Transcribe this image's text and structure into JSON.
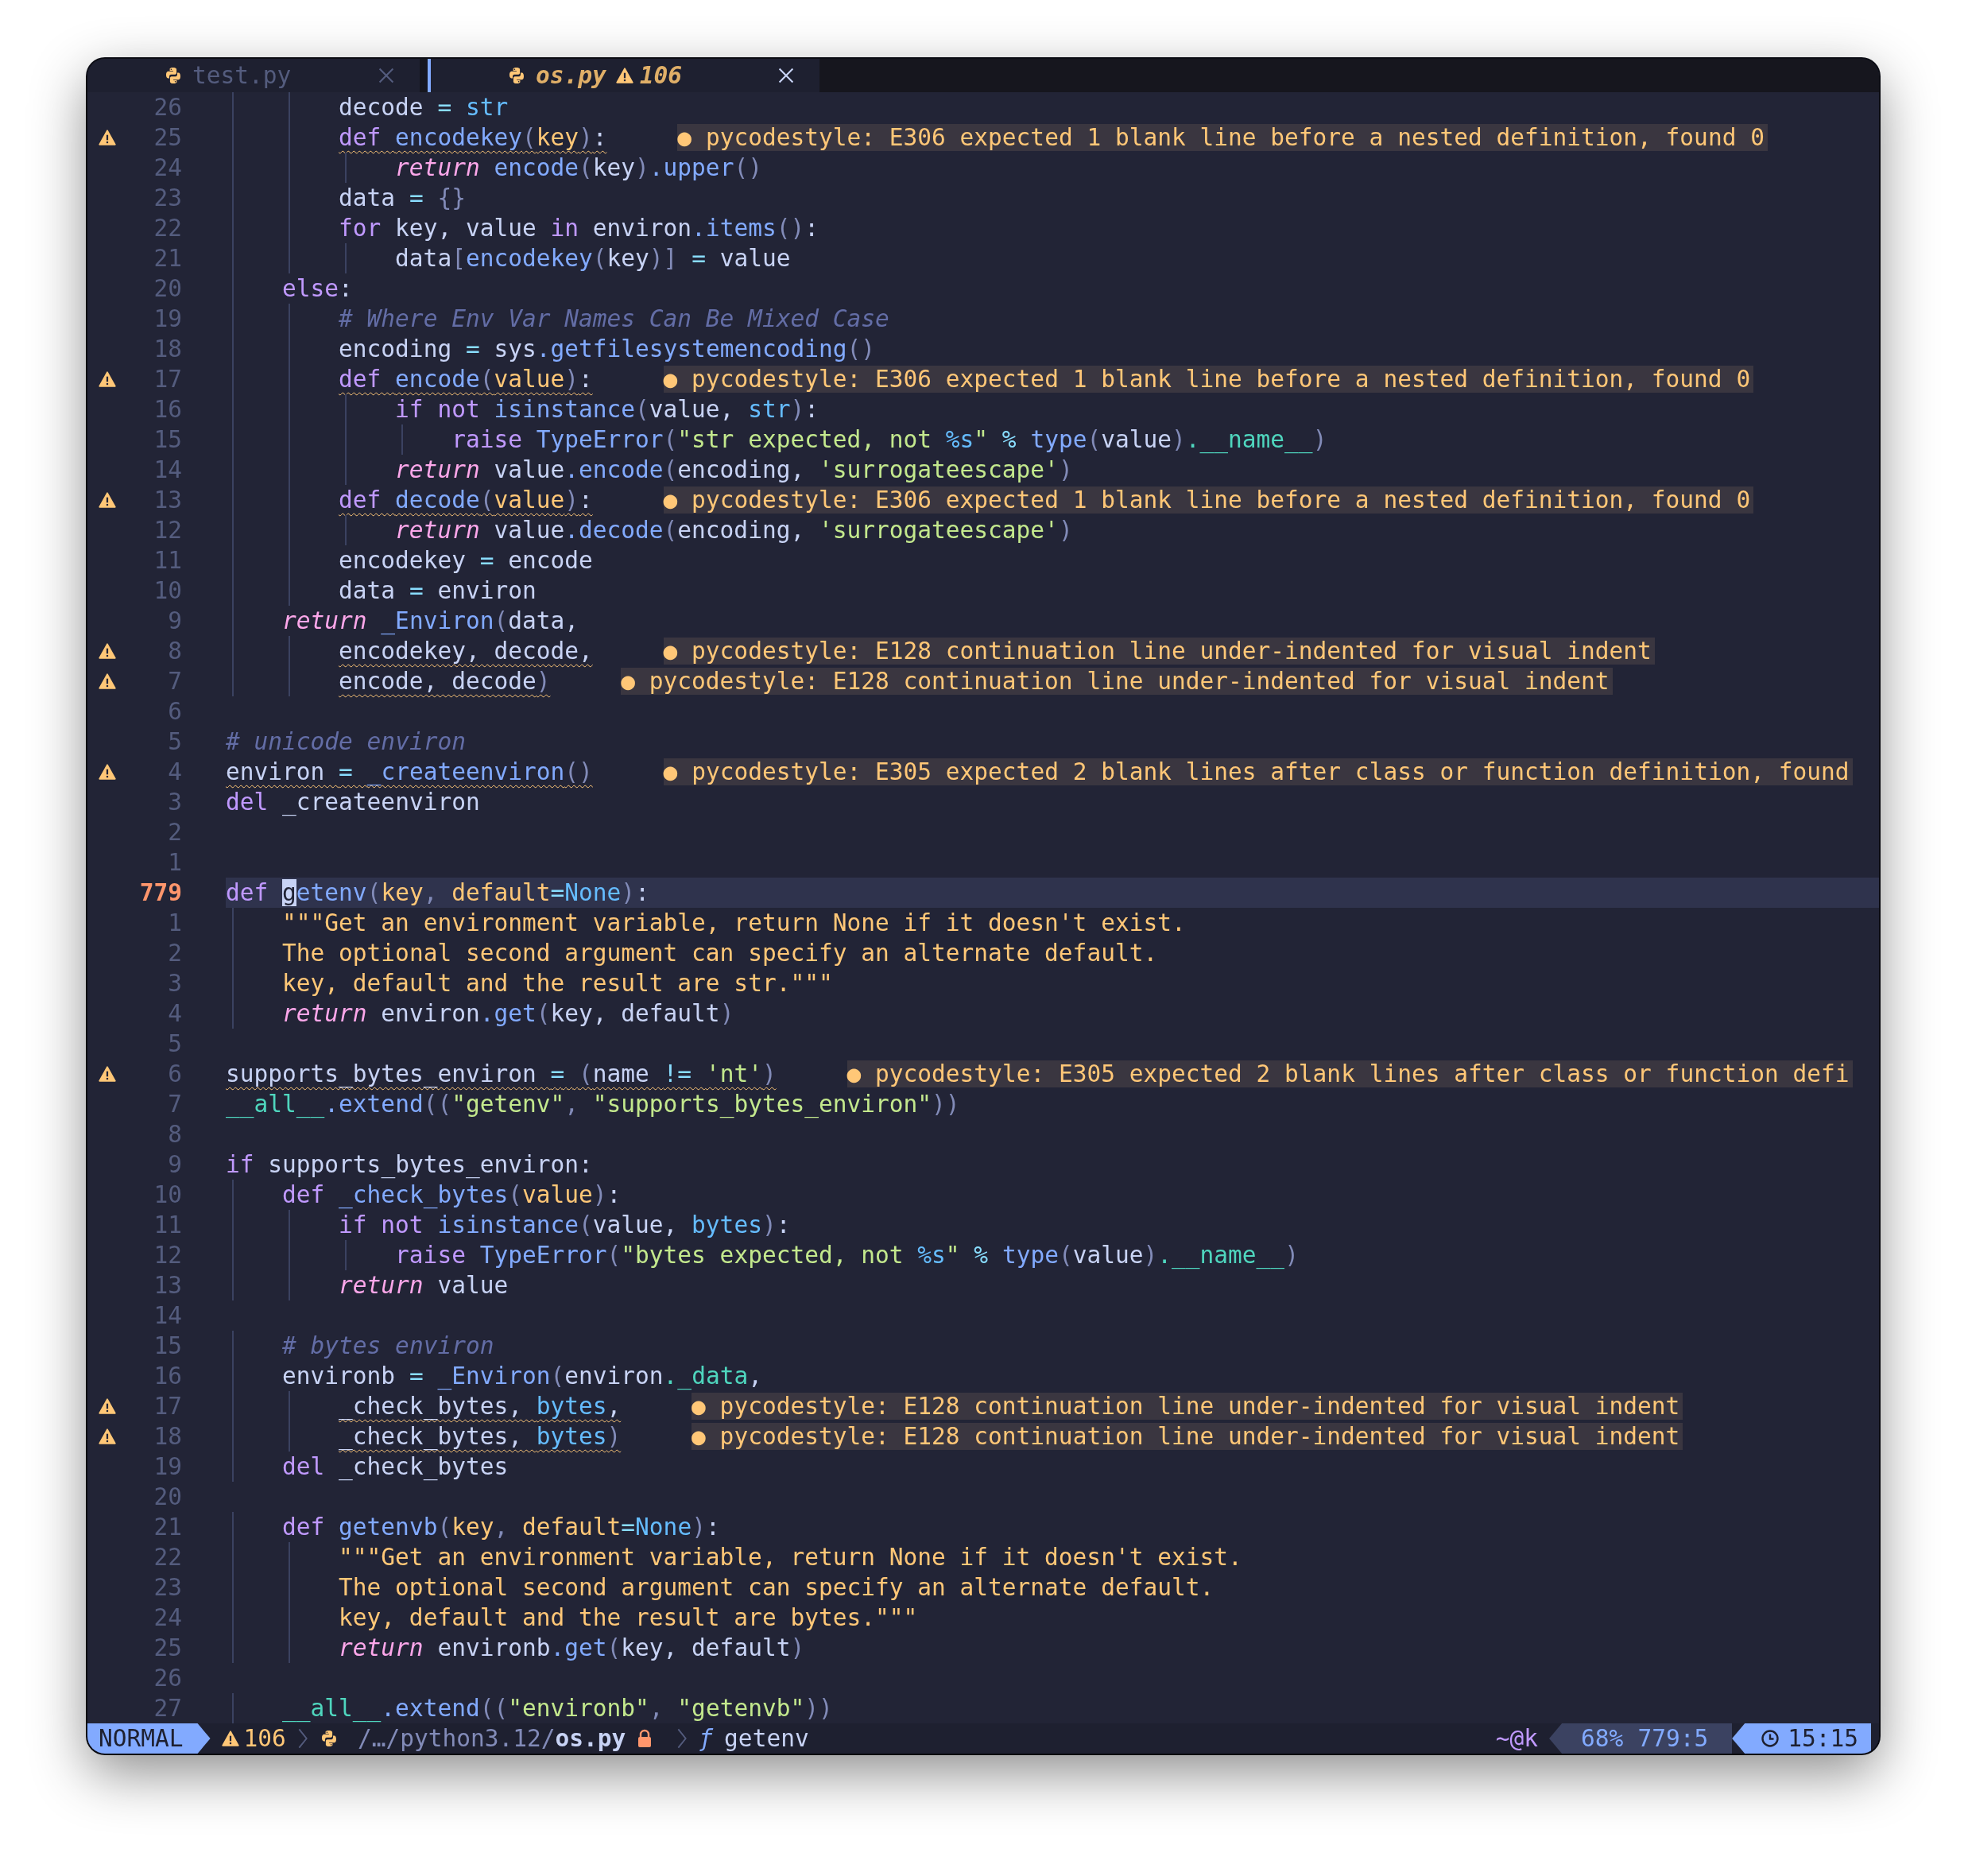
{
  "tabs": [
    {
      "label": "test.py",
      "selected": false
    },
    {
      "label": "os.py",
      "selected": true,
      "warnings": "106"
    }
  ],
  "lines": [
    {
      "number": "26",
      "warning": false,
      "current": false,
      "tokens": [
        {
          "kind": "tx",
          "text": "        decode "
        },
        {
          "kind": "op",
          "text": "= "
        },
        {
          "kind": "bi",
          "text": "str"
        }
      ]
    },
    {
      "number": "25",
      "warning": true,
      "current": false,
      "tokens": [
        {
          "kind": "kw",
          "text": "        def "
        },
        {
          "kind": "fn",
          "text": "encodekey"
        },
        {
          "kind": "pn",
          "text": "("
        },
        {
          "kind": "par",
          "text": "key"
        },
        {
          "kind": "pn",
          "text": ")"
        },
        {
          "kind": "tx",
          "text": ":"
        }
      ],
      "diagnostic": "● pycodestyle: E306 expected 1 blank line before a nested definition, found 0"
    },
    {
      "number": "24",
      "warning": false,
      "current": false,
      "tokens": [
        {
          "kind": "ret",
          "text": "            return "
        },
        {
          "kind": "fn",
          "text": "encode"
        },
        {
          "kind": "pn",
          "text": "("
        },
        {
          "kind": "tx",
          "text": "key"
        },
        {
          "kind": "pn",
          "text": ")"
        },
        {
          "kind": "fn",
          "text": ".upper"
        },
        {
          "kind": "pn",
          "text": "()"
        }
      ]
    },
    {
      "number": "23",
      "warning": false,
      "current": false,
      "tokens": [
        {
          "kind": "tx",
          "text": "        data "
        },
        {
          "kind": "op",
          "text": "= "
        },
        {
          "kind": "pn",
          "text": "{}"
        }
      ]
    },
    {
      "number": "22",
      "warning": false,
      "current": false,
      "tokens": [
        {
          "kind": "kw",
          "text": "        for "
        },
        {
          "kind": "tx",
          "text": "key, value "
        },
        {
          "kind": "kw",
          "text": "in "
        },
        {
          "kind": "tx",
          "text": "environ"
        },
        {
          "kind": "fn",
          "text": ".items"
        },
        {
          "kind": "pn",
          "text": "()"
        },
        {
          "kind": "tx",
          "text": ":"
        }
      ]
    },
    {
      "number": "21",
      "warning": false,
      "current": false,
      "tokens": [
        {
          "kind": "tx",
          "text": "            data"
        },
        {
          "kind": "pn",
          "text": "["
        },
        {
          "kind": "fn",
          "text": "encodekey"
        },
        {
          "kind": "pn",
          "text": "("
        },
        {
          "kind": "tx",
          "text": "key"
        },
        {
          "kind": "pn",
          "text": ")] "
        },
        {
          "kind": "op",
          "text": "= "
        },
        {
          "kind": "tx",
          "text": "value"
        }
      ]
    },
    {
      "number": "20",
      "warning": false,
      "current": false,
      "tokens": [
        {
          "kind": "kw",
          "text": "    else"
        },
        {
          "kind": "tx",
          "text": ":"
        }
      ]
    },
    {
      "number": "19",
      "warning": false,
      "current": false,
      "tokens": [
        {
          "kind": "cm",
          "text": "        # Where Env Var Names Can Be Mixed Case"
        }
      ]
    },
    {
      "number": "18",
      "warning": false,
      "current": false,
      "tokens": [
        {
          "kind": "tx",
          "text": "        encoding "
        },
        {
          "kind": "op",
          "text": "= "
        },
        {
          "kind": "tx",
          "text": "sys"
        },
        {
          "kind": "fn",
          "text": ".getfilesystemencoding"
        },
        {
          "kind": "pn",
          "text": "()"
        }
      ]
    },
    {
      "number": "17",
      "warning": true,
      "current": false,
      "tokens": [
        {
          "kind": "kw",
          "text": "        def "
        },
        {
          "kind": "fn",
          "text": "encode"
        },
        {
          "kind": "pn",
          "text": "("
        },
        {
          "kind": "par",
          "text": "value"
        },
        {
          "kind": "pn",
          "text": ")"
        },
        {
          "kind": "tx",
          "text": ":"
        }
      ],
      "diagnostic": "● pycodestyle: E306 expected 1 blank line before a nested definition, found 0"
    },
    {
      "number": "16",
      "warning": false,
      "current": false,
      "tokens": [
        {
          "kind": "kw",
          "text": "            if not "
        },
        {
          "kind": "fn",
          "text": "isinstance"
        },
        {
          "kind": "pn",
          "text": "("
        },
        {
          "kind": "tx",
          "text": "value, "
        },
        {
          "kind": "bi",
          "text": "str"
        },
        {
          "kind": "pn",
          "text": ")"
        },
        {
          "kind": "tx",
          "text": ":"
        }
      ]
    },
    {
      "number": "15",
      "warning": false,
      "current": false,
      "tokens": [
        {
          "kind": "kw",
          "text": "                raise "
        },
        {
          "kind": "fn",
          "text": "TypeError"
        },
        {
          "kind": "pn",
          "text": "("
        },
        {
          "kind": "str",
          "text": "\"str expected, not "
        },
        {
          "kind": "fmt",
          "text": "%s"
        },
        {
          "kind": "str",
          "text": "\" "
        },
        {
          "kind": "op",
          "text": "% "
        },
        {
          "kind": "fn",
          "text": "type"
        },
        {
          "kind": "pn",
          "text": "("
        },
        {
          "kind": "tx",
          "text": "value"
        },
        {
          "kind": "pn",
          "text": ")"
        },
        {
          "kind": "attr",
          "text": ".__name__"
        },
        {
          "kind": "pn",
          "text": ")"
        }
      ]
    },
    {
      "number": "14",
      "warning": false,
      "current": false,
      "tokens": [
        {
          "kind": "ret",
          "text": "            return "
        },
        {
          "kind": "tx",
          "text": "value"
        },
        {
          "kind": "fn",
          "text": ".encode"
        },
        {
          "kind": "pn",
          "text": "("
        },
        {
          "kind": "tx",
          "text": "encoding, "
        },
        {
          "kind": "str",
          "text": "'surrogateescape'"
        },
        {
          "kind": "pn",
          "text": ")"
        }
      ]
    },
    {
      "number": "13",
      "warning": true,
      "current": false,
      "tokens": [
        {
          "kind": "kw",
          "text": "        def "
        },
        {
          "kind": "fn",
          "text": "decode"
        },
        {
          "kind": "pn",
          "text": "("
        },
        {
          "kind": "par",
          "text": "value"
        },
        {
          "kind": "pn",
          "text": ")"
        },
        {
          "kind": "tx",
          "text": ":"
        }
      ],
      "diagnostic": "● pycodestyle: E306 expected 1 blank line before a nested definition, found 0"
    },
    {
      "number": "12",
      "warning": false,
      "current": false,
      "tokens": [
        {
          "kind": "ret",
          "text": "            return "
        },
        {
          "kind": "tx",
          "text": "value"
        },
        {
          "kind": "fn",
          "text": ".decode"
        },
        {
          "kind": "pn",
          "text": "("
        },
        {
          "kind": "tx",
          "text": "encoding, "
        },
        {
          "kind": "str",
          "text": "'surrogateescape'"
        },
        {
          "kind": "pn",
          "text": ")"
        }
      ]
    },
    {
      "number": "11",
      "warning": false,
      "current": false,
      "tokens": [
        {
          "kind": "tx",
          "text": "        encodekey "
        },
        {
          "kind": "op",
          "text": "= "
        },
        {
          "kind": "tx",
          "text": "encode"
        }
      ]
    },
    {
      "number": "10",
      "warning": false,
      "current": false,
      "tokens": [
        {
          "kind": "tx",
          "text": "        data "
        },
        {
          "kind": "op",
          "text": "= "
        },
        {
          "kind": "tx",
          "text": "environ"
        }
      ]
    },
    {
      "number": "9",
      "warning": false,
      "current": false,
      "tokens": [
        {
          "kind": "ret",
          "text": "    return "
        },
        {
          "kind": "fn",
          "text": "_Environ"
        },
        {
          "kind": "pn",
          "text": "("
        },
        {
          "kind": "tx",
          "text": "data,"
        }
      ]
    },
    {
      "number": "8",
      "warning": true,
      "current": false,
      "tokens": [
        {
          "kind": "tx",
          "text": "        encodekey, decode,"
        }
      ],
      "diagnostic": "● pycodestyle: E128 continuation line under-indented for visual indent"
    },
    {
      "number": "7",
      "warning": true,
      "current": false,
      "tokens": [
        {
          "kind": "tx",
          "text": "        encode, decode"
        },
        {
          "kind": "pn",
          "text": ")"
        }
      ],
      "diagnostic": "● pycodestyle: E128 continuation line under-indented for visual indent"
    },
    {
      "number": "6",
      "warning": false,
      "current": false
    },
    {
      "number": "5",
      "warning": false,
      "current": false,
      "tokens": [
        {
          "kind": "cm",
          "text": "# unicode environ"
        }
      ]
    },
    {
      "number": "4",
      "warning": true,
      "current": false,
      "tokens": [
        {
          "kind": "tx",
          "text": "environ "
        },
        {
          "kind": "op",
          "text": "= "
        },
        {
          "kind": "fn",
          "text": "_createenviron"
        },
        {
          "kind": "pn",
          "text": "()"
        }
      ],
      "diagnostic": "● pycodestyle: E305 expected 2 blank lines after class or function definition, found"
    },
    {
      "number": "3",
      "warning": false,
      "current": false,
      "tokens": [
        {
          "kind": "kw",
          "text": "del "
        },
        {
          "kind": "tx",
          "text": "_createenviron"
        }
      ]
    },
    {
      "number": "2",
      "warning": false,
      "current": false
    },
    {
      "number": "1",
      "warning": false,
      "current": false
    },
    {
      "number": "779",
      "warning": false,
      "current": true,
      "tokens": [
        {
          "kind": "kw",
          "text": "def "
        },
        {
          "kind": "cur",
          "text": "g"
        },
        {
          "kind": "fn",
          "text": "etenv"
        },
        {
          "kind": "pn",
          "text": "("
        },
        {
          "kind": "par",
          "text": "key"
        },
        {
          "kind": "pn",
          "text": ", "
        },
        {
          "kind": "par",
          "text": "default"
        },
        {
          "kind": "op",
          "text": "="
        },
        {
          "kind": "bi",
          "text": "None"
        },
        {
          "kind": "pn",
          "text": ")"
        },
        {
          "kind": "tx",
          "text": ":"
        }
      ]
    },
    {
      "number": "1",
      "warning": false,
      "current": false,
      "tokens": [
        {
          "kind": "doc",
          "text": "    \"\"\"Get an environment variable, return None if it doesn't exist."
        }
      ]
    },
    {
      "number": "2",
      "warning": false,
      "current": false,
      "tokens": [
        {
          "kind": "doc",
          "text": "    The optional second argument can specify an alternate default."
        }
      ]
    },
    {
      "number": "3",
      "warning": false,
      "current": false,
      "tokens": [
        {
          "kind": "doc",
          "text": "    key, default and the result are str.\"\"\""
        }
      ]
    },
    {
      "number": "4",
      "warning": false,
      "current": false,
      "tokens": [
        {
          "kind": "ret",
          "text": "    return "
        },
        {
          "kind": "tx",
          "text": "environ"
        },
        {
          "kind": "fn",
          "text": ".get"
        },
        {
          "kind": "pn",
          "text": "("
        },
        {
          "kind": "tx",
          "text": "key, default"
        },
        {
          "kind": "pn",
          "text": ")"
        }
      ]
    },
    {
      "number": "5",
      "warning": false,
      "current": false
    },
    {
      "number": "6",
      "warning": true,
      "current": false,
      "tokens": [
        {
          "kind": "tx",
          "text": "supports_bytes_environ "
        },
        {
          "kind": "op",
          "text": "= "
        },
        {
          "kind": "pn",
          "text": "("
        },
        {
          "kind": "tx",
          "text": "name "
        },
        {
          "kind": "op",
          "text": "!= "
        },
        {
          "kind": "str",
          "text": "'nt'"
        },
        {
          "kind": "pn",
          "text": ")"
        }
      ],
      "diagnostic": "● pycodestyle: E305 expected 2 blank lines after class or function defi"
    },
    {
      "number": "7",
      "warning": false,
      "current": false,
      "tokens": [
        {
          "kind": "attr",
          "text": "__all__"
        },
        {
          "kind": "fn",
          "text": ".extend"
        },
        {
          "kind": "pn",
          "text": "(("
        },
        {
          "kind": "str",
          "text": "\"getenv\""
        },
        {
          "kind": "pn",
          "text": ", "
        },
        {
          "kind": "str",
          "text": "\"supports_bytes_environ\""
        },
        {
          "kind": "pn",
          "text": "))"
        }
      ]
    },
    {
      "number": "8",
      "warning": false,
      "current": false
    },
    {
      "number": "9",
      "warning": false,
      "current": false,
      "tokens": [
        {
          "kind": "kw",
          "text": "if "
        },
        {
          "kind": "tx",
          "text": "supports_bytes_environ:"
        }
      ]
    },
    {
      "number": "10",
      "warning": false,
      "current": false,
      "tokens": [
        {
          "kind": "kw",
          "text": "    def "
        },
        {
          "kind": "fn",
          "text": "_check_bytes"
        },
        {
          "kind": "pn",
          "text": "("
        },
        {
          "kind": "par",
          "text": "value"
        },
        {
          "kind": "pn",
          "text": ")"
        },
        {
          "kind": "tx",
          "text": ":"
        }
      ]
    },
    {
      "number": "11",
      "warning": false,
      "current": false,
      "tokens": [
        {
          "kind": "kw",
          "text": "        if not "
        },
        {
          "kind": "fn",
          "text": "isinstance"
        },
        {
          "kind": "pn",
          "text": "("
        },
        {
          "kind": "tx",
          "text": "value, "
        },
        {
          "kind": "bi",
          "text": "bytes"
        },
        {
          "kind": "pn",
          "text": ")"
        },
        {
          "kind": "tx",
          "text": ":"
        }
      ]
    },
    {
      "number": "12",
      "warning": false,
      "current": false,
      "tokens": [
        {
          "kind": "kw",
          "text": "            raise "
        },
        {
          "kind": "fn",
          "text": "TypeError"
        },
        {
          "kind": "pn",
          "text": "("
        },
        {
          "kind": "str",
          "text": "\"bytes expected, not "
        },
        {
          "kind": "fmt",
          "text": "%s"
        },
        {
          "kind": "str",
          "text": "\" "
        },
        {
          "kind": "op",
          "text": "% "
        },
        {
          "kind": "fn",
          "text": "type"
        },
        {
          "kind": "pn",
          "text": "("
        },
        {
          "kind": "tx",
          "text": "value"
        },
        {
          "kind": "pn",
          "text": ")"
        },
        {
          "kind": "attr",
          "text": ".__name__"
        },
        {
          "kind": "pn",
          "text": ")"
        }
      ]
    },
    {
      "number": "13",
      "warning": false,
      "current": false,
      "tokens": [
        {
          "kind": "ret",
          "text": "        return "
        },
        {
          "kind": "tx",
          "text": "value"
        }
      ]
    },
    {
      "number": "14",
      "warning": false,
      "current": false
    },
    {
      "number": "15",
      "warning": false,
      "current": false,
      "tokens": [
        {
          "kind": "cm",
          "text": "    # bytes environ"
        }
      ]
    },
    {
      "number": "16",
      "warning": false,
      "current": false,
      "tokens": [
        {
          "kind": "tx",
          "text": "    environb "
        },
        {
          "kind": "op",
          "text": "= "
        },
        {
          "kind": "fn",
          "text": "_Environ"
        },
        {
          "kind": "pn",
          "text": "("
        },
        {
          "kind": "tx",
          "text": "environ"
        },
        {
          "kind": "attr",
          "text": "._data"
        },
        {
          "kind": "tx",
          "text": ","
        }
      ]
    },
    {
      "number": "17",
      "warning": true,
      "current": false,
      "tokens": [
        {
          "kind": "tx",
          "text": "        _check_bytes, "
        },
        {
          "kind": "bi",
          "text": "bytes"
        },
        {
          "kind": "tx",
          "text": ","
        }
      ],
      "diagnostic": "● pycodestyle: E128 continuation line under-indented for visual indent"
    },
    {
      "number": "18",
      "warning": true,
      "current": false,
      "tokens": [
        {
          "kind": "tx",
          "text": "        _check_bytes, "
        },
        {
          "kind": "bi",
          "text": "bytes"
        },
        {
          "kind": "pn",
          "text": ")"
        }
      ],
      "diagnostic": "● pycodestyle: E128 continuation line under-indented for visual indent"
    },
    {
      "number": "19",
      "warning": false,
      "current": false,
      "tokens": [
        {
          "kind": "kw",
          "text": "    del "
        },
        {
          "kind": "tx",
          "text": "_check_bytes"
        }
      ]
    },
    {
      "number": "20",
      "warning": false,
      "current": false
    },
    {
      "number": "21",
      "warning": false,
      "current": false,
      "tokens": [
        {
          "kind": "kw",
          "text": "    def "
        },
        {
          "kind": "fn",
          "text": "getenvb"
        },
        {
          "kind": "pn",
          "text": "("
        },
        {
          "kind": "par",
          "text": "key"
        },
        {
          "kind": "pn",
          "text": ", "
        },
        {
          "kind": "par",
          "text": "default"
        },
        {
          "kind": "op",
          "text": "="
        },
        {
          "kind": "bi",
          "text": "None"
        },
        {
          "kind": "pn",
          "text": ")"
        },
        {
          "kind": "tx",
          "text": ":"
        }
      ]
    },
    {
      "number": "22",
      "warning": false,
      "current": false,
      "tokens": [
        {
          "kind": "doc",
          "text": "        \"\"\"Get an environment variable, return None if it doesn't exist."
        }
      ]
    },
    {
      "number": "23",
      "warning": false,
      "current": false,
      "tokens": [
        {
          "kind": "doc",
          "text": "        The optional second argument can specify an alternate default."
        }
      ]
    },
    {
      "number": "24",
      "warning": false,
      "current": false,
      "tokens": [
        {
          "kind": "doc",
          "text": "        key, default and the result are bytes.\"\"\""
        }
      ]
    },
    {
      "number": "25",
      "warning": false,
      "current": false,
      "tokens": [
        {
          "kind": "ret",
          "text": "        return "
        },
        {
          "kind": "tx",
          "text": "environb"
        },
        {
          "kind": "fn",
          "text": ".get"
        },
        {
          "kind": "pn",
          "text": "("
        },
        {
          "kind": "tx",
          "text": "key, default"
        },
        {
          "kind": "pn",
          "text": ")"
        }
      ]
    },
    {
      "number": "26",
      "warning": false,
      "current": false
    },
    {
      "number": "27",
      "warning": false,
      "current": false,
      "tokens": [
        {
          "kind": "attr",
          "text": "    __all__"
        },
        {
          "kind": "fn",
          "text": ".extend"
        },
        {
          "kind": "pn",
          "text": "(("
        },
        {
          "kind": "str",
          "text": "\"environb\""
        },
        {
          "kind": "pn",
          "text": ", "
        },
        {
          "kind": "str",
          "text": "\"getenvb\""
        },
        {
          "kind": "pn",
          "text": "))"
        }
      ]
    }
  ],
  "status_bar": {
    "mode": "NORMAL",
    "warnings": "106",
    "directory": "/…/python3.12/",
    "file_name": "os.py",
    "readonly": true,
    "symbol_glyph": "ƒ",
    "symbol": "getenv",
    "host": "~@k",
    "scroll_percent": "68%",
    "cursor_position": "779:5",
    "clock": "15:15"
  }
}
